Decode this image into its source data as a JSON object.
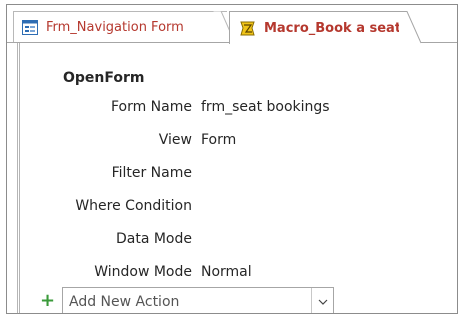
{
  "tabs": [
    {
      "label": "Frm_Navigation Form",
      "icon": "form-icon",
      "active": false
    },
    {
      "label": "Macro_Book a seat",
      "icon": "macro-icon",
      "active": true
    }
  ],
  "macro": {
    "action": "OpenForm",
    "arguments": [
      {
        "label": "Form Name",
        "value": "frm_seat bookings"
      },
      {
        "label": "View",
        "value": "Form"
      },
      {
        "label": "Filter Name",
        "value": ""
      },
      {
        "label": "Where Condition",
        "value": ""
      },
      {
        "label": "Data Mode",
        "value": ""
      },
      {
        "label": "Window Mode",
        "value": "Normal"
      }
    ],
    "add_action": {
      "icon": "plus-icon",
      "placeholder": "Add New Action",
      "dropdown_icon": "chevron-down-icon"
    }
  },
  "colors": {
    "tab_text": "#b5382e",
    "plus": "#3a9a3a",
    "border": "#a6a6a6"
  }
}
